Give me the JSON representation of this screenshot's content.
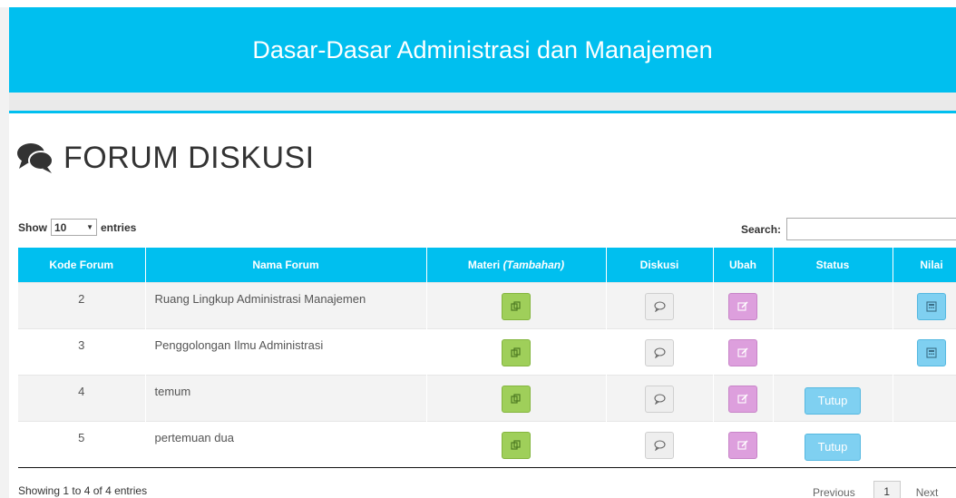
{
  "banner": {
    "title": "Dasar-Dasar Administrasi dan Manajemen"
  },
  "heading": {
    "icon": "comments-icon",
    "title": "FORUM DISKUSI"
  },
  "length": {
    "show_label": "Show",
    "value": "10",
    "entries_label": "entries"
  },
  "search": {
    "label": "Search:",
    "value": ""
  },
  "table": {
    "headers": {
      "kode": "Kode Forum",
      "nama": "Nama Forum",
      "materi": "Materi",
      "materi_em": "(Tambahan)",
      "diskusi": "Diskusi",
      "ubah": "Ubah",
      "status": "Status",
      "nilai": "Nilai"
    },
    "rows": [
      {
        "kode": "2",
        "nama": "Ruang Lingkup Administrasi Manajemen",
        "status": "",
        "has_nilai": true
      },
      {
        "kode": "3",
        "nama": "Penggolongan Ilmu Administrasi",
        "status": "",
        "has_nilai": true
      },
      {
        "kode": "4",
        "nama": "temum",
        "status": "Tutup",
        "has_nilai": false
      },
      {
        "kode": "5",
        "nama": "pertemuan dua",
        "status": "Tutup",
        "has_nilai": false
      }
    ],
    "icons": {
      "materi": "copy-icon",
      "diskusi": "comment-icon",
      "ubah": "edit-icon",
      "nilai": "calculator-icon"
    }
  },
  "footer": {
    "info": "Showing 1 to 4 of 4 entries",
    "previous": "Previous",
    "page": "1",
    "next": "Next"
  },
  "colors": {
    "primary": "#00bfef",
    "green_button": "#9fcf5a",
    "pink_button": "#dd9fdd",
    "blue_button": "#7fd0f1"
  }
}
